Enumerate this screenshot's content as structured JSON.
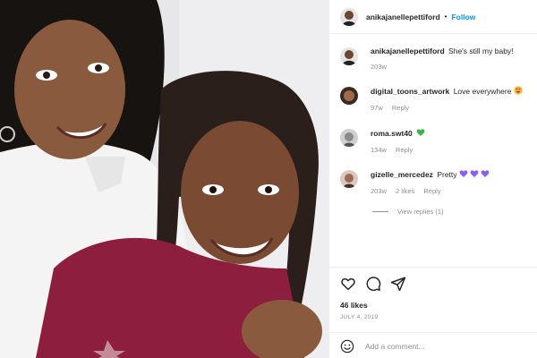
{
  "post": {
    "photo_alt": "photo",
    "username": "anikajanellepettiford",
    "separator": "•",
    "follow_label": "Follow"
  },
  "caption": {
    "username": "anikajanellepettiford",
    "text": "She's still my baby!",
    "age": "203w"
  },
  "comments": [
    {
      "username": "digital_toons_artwork",
      "text": "Love everywhere",
      "emoji": "heart-eyes-emoji",
      "age": "97w",
      "likes": "",
      "reply_label": "Reply"
    },
    {
      "username": "roma.swt40",
      "text": "",
      "emoji": "green-heart-emoji",
      "age": "134w",
      "likes": "",
      "reply_label": "Reply"
    },
    {
      "username": "gizelle_mercedez",
      "text": "Pretty",
      "emoji": "purple-hearts-emoji",
      "age": "203w",
      "likes": "2 likes",
      "reply_label": "Reply"
    }
  ],
  "view_replies_label": "View replies (1)",
  "actions": {
    "icons": [
      "heart-icon",
      "comment-icon",
      "share-icon"
    ],
    "likes_count": "46 likes",
    "date": "JULY 4, 2019"
  },
  "add_comment": {
    "placeholder": "Add a comment..."
  },
  "colors": {
    "link_blue": "#0095f6",
    "muted": "#8e8e8e",
    "text": "#262626"
  }
}
